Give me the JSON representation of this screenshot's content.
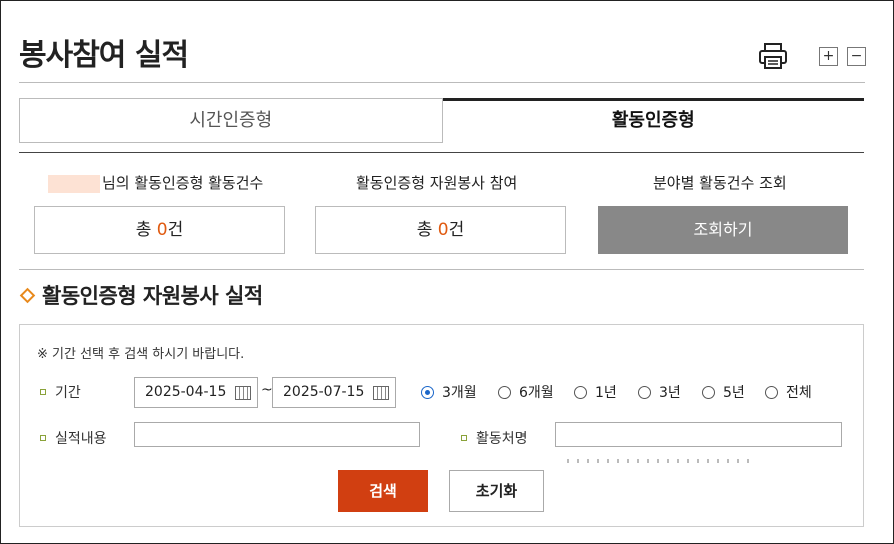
{
  "page": {
    "title": "봉사참여 실적"
  },
  "toolbar": {
    "plus_label": "+",
    "minus_label": "−"
  },
  "tabs": [
    {
      "label": "시간인증형",
      "active": false
    },
    {
      "label": "활동인증형",
      "active": true
    }
  ],
  "stats": {
    "user_activity_label": "님의 활동인증형 활동건수",
    "volunteer_label": "활동인증형 자원봉사 참여",
    "category_label": "분야별 활동건수 조회",
    "count_prefix": "총 ",
    "user_count": "0",
    "volunteer_count": "0",
    "count_suffix": "건",
    "query_button": "조회하기"
  },
  "section": {
    "title": "활동인증형 자원봉사 실적"
  },
  "search": {
    "notice": "※ 기간 선택 후 검색 하시기 바랍니다.",
    "period_label": "기간",
    "date_from": "2025-04-15",
    "date_separator": "~",
    "date_to": "2025-07-15",
    "period_options": [
      {
        "label": "3개월",
        "selected": true
      },
      {
        "label": "6개월",
        "selected": false
      },
      {
        "label": "1년",
        "selected": false
      },
      {
        "label": "3년",
        "selected": false
      },
      {
        "label": "5년",
        "selected": false
      },
      {
        "label": "전체",
        "selected": false
      }
    ],
    "content_label": "실적내용",
    "content_value": "",
    "place_label": "활동처명",
    "place_value": "",
    "search_button": "검색",
    "reset_button": "초기화"
  },
  "colors": {
    "accent": "#e05a10",
    "search_button": "#d13f11",
    "query_button": "#888888",
    "radio_selected": "#1a66c9",
    "bullet": "#8aa23a",
    "diamond": "#e8891c"
  },
  "icons": [
    "print-icon",
    "plus-icon",
    "minus-icon",
    "calendar-icon",
    "diamond-icon"
  ]
}
